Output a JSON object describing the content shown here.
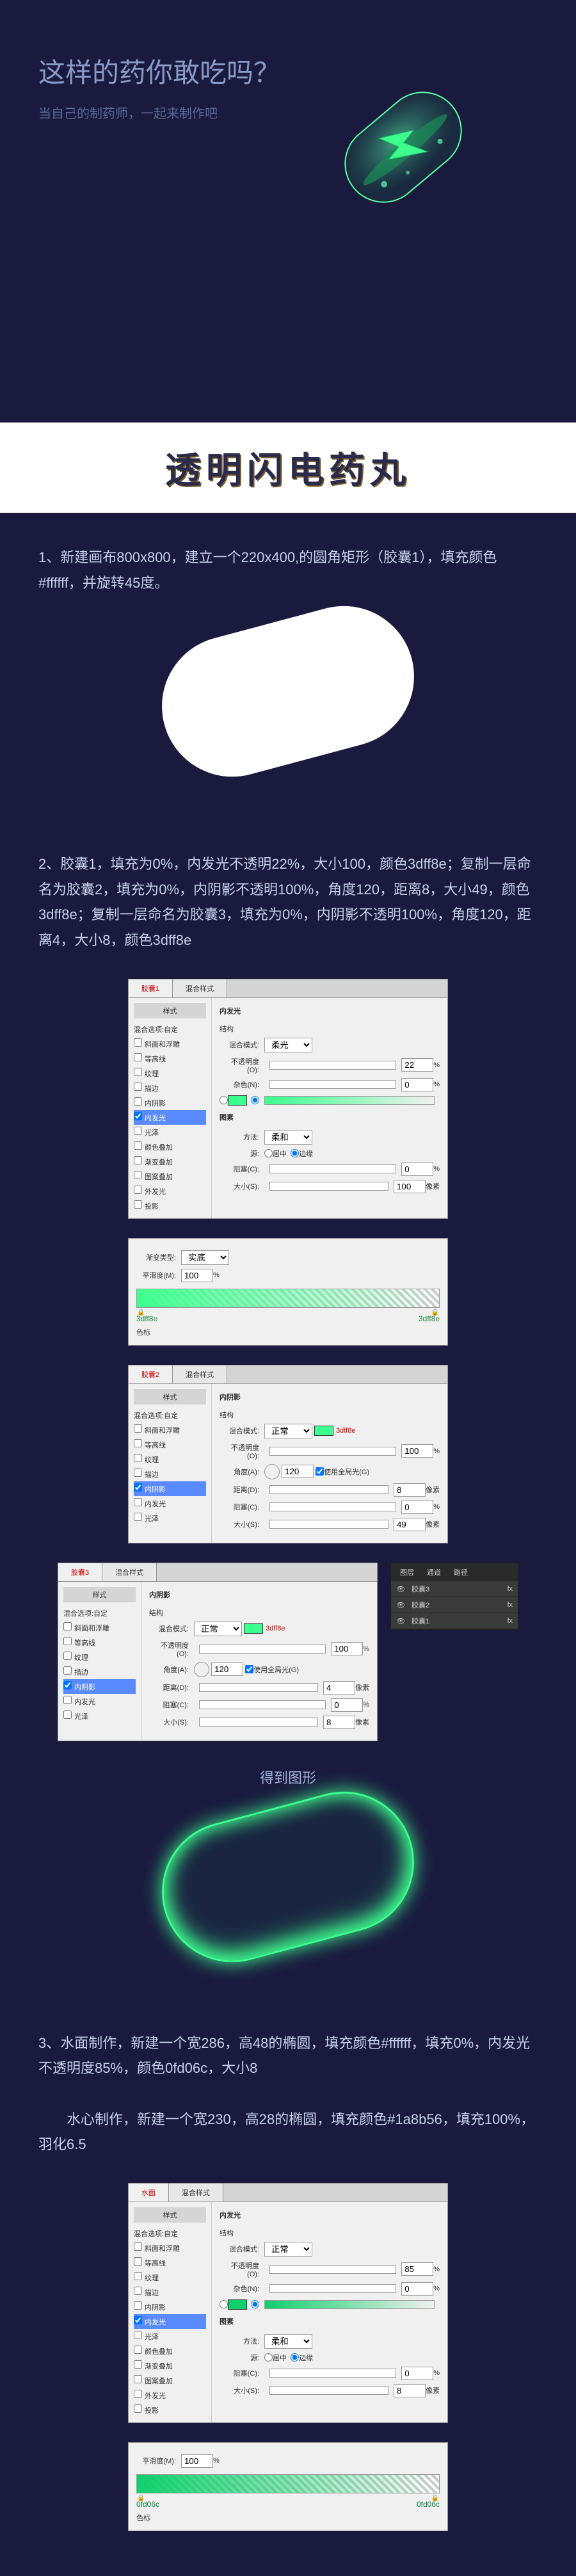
{
  "hero": {
    "title": "这样的药你敢吃吗？",
    "subtitle": "当自己的制药师，一起来制作吧"
  },
  "banner": "透明闪电药丸",
  "step1": "1、新建画布800x800，建立一个220x400,的圆角矩形（胶囊1），填充颜色#ffffff，并旋转45度。",
  "step2": "2、胶囊1，填充为0%，内发光不透明22%，大小100，颜色3dff8e；复制一层命名为胶囊2，填充为0%，内阴影不透明100%，角度120，距离8，大小49，颜色3dff8e；复制一层命名为胶囊3，填充为0%，内阴影不透明100%，角度120，距离4，大小8，颜色3dff8e",
  "panel1": {
    "tab": "胶囊1",
    "tab2": "混合样式",
    "leftTitle": "样式",
    "leftSub": "混合选项:自定",
    "opts": [
      "斜面和浮雕",
      "等高线",
      "纹理",
      "描边",
      "内阴影",
      "内发光",
      "光泽",
      "颜色叠加",
      "渐变叠加",
      "图案叠加",
      "外发光",
      "投影"
    ],
    "sectionTitle": "内发光",
    "sectionSub": "结构",
    "blendLabel": "混合模式:",
    "blendVal": "柔光",
    "opLabel": "不透明度(O):",
    "opVal": "22",
    "opUnit": "%",
    "noiseLabel": "杂色(N):",
    "noiseVal": "0",
    "noiseUnit": "%",
    "elemTitle": "图素",
    "methodLabel": "方法:",
    "methodVal": "柔和",
    "sourceLabel": "源:",
    "sourceCenter": "居中",
    "sourceEdge": "边缘",
    "chokeLabel": "阻塞(C):",
    "chokeVal": "0",
    "chokeUnit": "%",
    "sizeLabel": "大小(S):",
    "sizeVal": "100",
    "sizeUnit": "像素"
  },
  "gradient": {
    "typeLabel": "渐变类型:",
    "typeVal": "实底",
    "smoothLabel": "平滑度(M):",
    "smoothVal": "100",
    "smoothUnit": "%",
    "colorLabel": "色标",
    "left": "3dff8e",
    "right": "3dff8e"
  },
  "panel2": {
    "tab": "胶囊2",
    "tab2": "混合样式",
    "sectionTitle": "内阴影",
    "sectionSub": "结构",
    "blendLabel": "混合模式:",
    "blendVal": "正常",
    "colorHex": "3dff8e",
    "opLabel": "不透明度(O):",
    "opVal": "100",
    "opUnit": "%",
    "angleLabel": "角度(A):",
    "angleVal": "120",
    "angleCheck": "使用全局光(G)",
    "distLabel": "距离(D):",
    "distVal": "8",
    "distUnit": "像素",
    "chokeLabel": "阻塞(C):",
    "chokeVal": "0",
    "chokeUnit": "%",
    "sizeLabel": "大小(S):",
    "sizeVal": "49",
    "sizeUnit": "像素"
  },
  "panel3": {
    "tab": "胶囊3",
    "tab2": "混合样式",
    "sectionTitle": "内阴影",
    "sectionSub": "结构",
    "blendLabel": "混合模式:",
    "blendVal": "正常",
    "colorHex": "3dff8e",
    "opLabel": "不透明度(O):",
    "opVal": "100",
    "opUnit": "%",
    "angleLabel": "角度(A):",
    "angleVal": "120",
    "angleCheck": "使用全局光(G)",
    "distLabel": "距离(D):",
    "distVal": "4",
    "distUnit": "像素",
    "chokeLabel": "阻塞(C):",
    "chokeVal": "0",
    "chokeUnit": "%",
    "sizeLabel": "大小(S):",
    "sizeVal": "8",
    "sizeUnit": "像素"
  },
  "layers": {
    "tab1": "图层",
    "tab2": "通道",
    "tab3": "路径",
    "items": [
      "胶囊3",
      "胶囊2",
      "胶囊1"
    ],
    "fx": "fx"
  },
  "resultLabel": "得到图形",
  "step3": "3、水面制作，新建一个宽286，高48的椭圆，填充颜色#ffffff，填充0%，内发光不透明度85%，颜色0fd06c，大小8",
  "step3b": "　　水心制作，新建一个宽230，高28的椭圆，填充颜色#1a8b56，填充100%，羽化6.5",
  "panel4": {
    "tab": "水面",
    "tab2": "混合样式",
    "sectionTitle": "内发光",
    "sectionSub": "结构",
    "blendLabel": "混合模式:",
    "blendVal": "正常",
    "opLabel": "不透明度(O):",
    "opVal": "85",
    "opUnit": "%",
    "noiseLabel": "杂色(N):",
    "noiseVal": "0",
    "noiseUnit": "%",
    "elemTitle": "图素",
    "methodLabel": "方法:",
    "methodVal": "柔和",
    "sourceLabel": "源:",
    "sourceCenter": "居中",
    "sourceEdge": "边缘",
    "chokeLabel": "阻塞(C):",
    "chokeVal": "0",
    "chokeUnit": "%",
    "sizeLabel": "大小(S):",
    "sizeVal": "8",
    "sizeUnit": "像素"
  },
  "gradient2": {
    "smoothLabel": "平滑度(M):",
    "smoothVal": "100",
    "smoothUnit": "%",
    "colorLabel": "色标",
    "left": "0fd06c",
    "right": "0fd06c"
  }
}
